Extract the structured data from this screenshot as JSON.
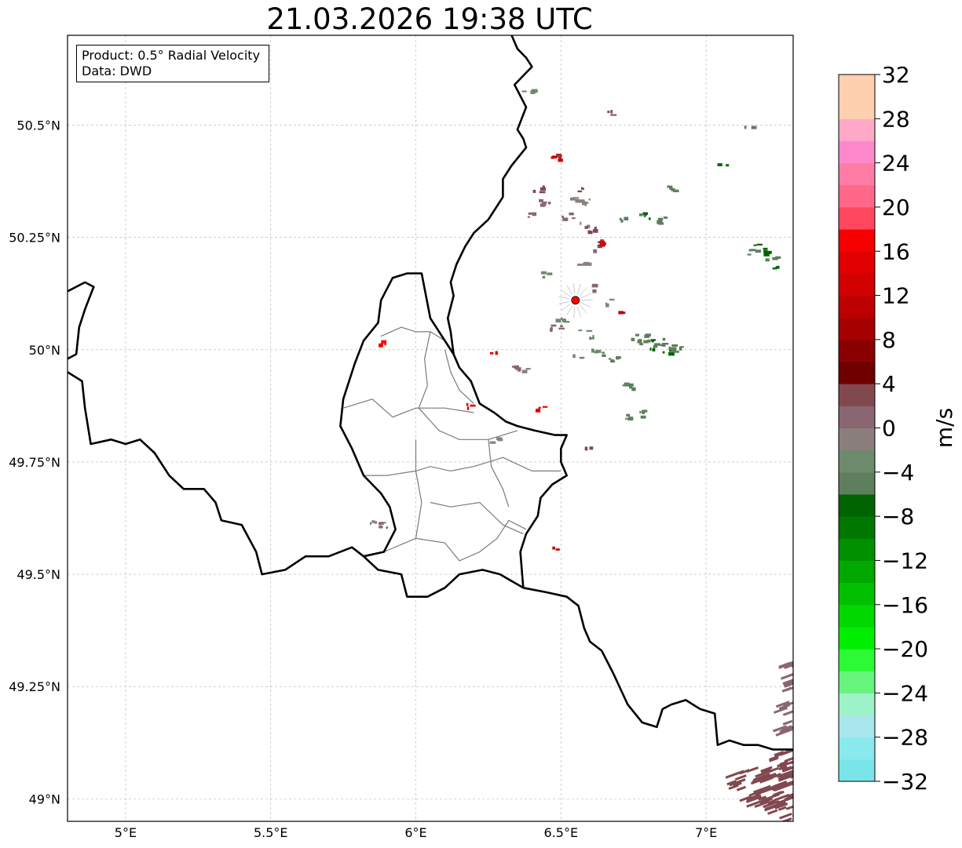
{
  "title": "21.03.2026 19:38 UTC",
  "info_box": {
    "product": "Product: 0.5° Radial Velocity",
    "data_source": "Data: DWD"
  },
  "map": {
    "extent": {
      "lon_min": 4.8,
      "lon_max": 7.3,
      "lat_min": 48.95,
      "lat_max": 50.7
    },
    "gridlines": true,
    "lon_ticks": [
      {
        "value": 5.0,
        "label": "5°E"
      },
      {
        "value": 5.5,
        "label": "5.5°E"
      },
      {
        "value": 6.0,
        "label": "6°E"
      },
      {
        "value": 6.5,
        "label": "6.5°E"
      },
      {
        "value": 7.0,
        "label": "7°E"
      }
    ],
    "lat_ticks": [
      {
        "value": 50.5,
        "label": "50.5°N"
      },
      {
        "value": 50.25,
        "label": "50.25°N"
      },
      {
        "value": 50.0,
        "label": "50°N"
      },
      {
        "value": 49.75,
        "label": "49.75°N"
      },
      {
        "value": 49.5,
        "label": "49.5°N"
      },
      {
        "value": 49.25,
        "label": "49.25°N"
      },
      {
        "value": 49.0,
        "label": "49°N"
      }
    ],
    "radar_site": {
      "lon": 6.55,
      "lat": 50.11,
      "color": "#ff0000"
    },
    "borders": {
      "belgium_germany": [
        [
          6.33,
          50.7
        ],
        [
          6.35,
          50.67
        ],
        [
          6.38,
          50.65
        ],
        [
          6.4,
          50.63
        ],
        [
          6.37,
          50.61
        ],
        [
          6.34,
          50.59
        ],
        [
          6.38,
          50.54
        ],
        [
          6.35,
          50.49
        ],
        [
          6.37,
          50.47
        ],
        [
          6.38,
          50.45
        ],
        [
          6.33,
          50.41
        ],
        [
          6.3,
          50.38
        ],
        [
          6.3,
          50.34
        ],
        [
          6.25,
          50.29
        ],
        [
          6.2,
          50.26
        ],
        [
          6.17,
          50.23
        ],
        [
          6.14,
          50.19
        ],
        [
          6.12,
          50.15
        ],
        [
          6.13,
          50.12
        ],
        [
          6.11,
          50.07
        ],
        [
          6.12,
          50.04
        ],
        [
          6.13,
          49.99
        ]
      ],
      "lux_germany": [
        [
          6.13,
          49.99
        ],
        [
          6.15,
          49.96
        ],
        [
          6.19,
          49.93
        ],
        [
          6.22,
          49.88
        ],
        [
          6.27,
          49.86
        ],
        [
          6.31,
          49.84
        ],
        [
          6.35,
          49.83
        ],
        [
          6.41,
          49.82
        ],
        [
          6.48,
          49.81
        ],
        [
          6.52,
          49.81
        ],
        [
          6.5,
          49.78
        ],
        [
          6.5,
          49.75
        ],
        [
          6.52,
          49.72
        ],
        [
          6.47,
          49.7
        ],
        [
          6.43,
          49.67
        ],
        [
          6.42,
          49.63
        ],
        [
          6.38,
          49.59
        ],
        [
          6.36,
          49.55
        ],
        [
          6.37,
          49.47
        ]
      ],
      "lux_belgium": [
        [
          6.13,
          49.99
        ],
        [
          6.05,
          50.07
        ],
        [
          6.02,
          50.17
        ],
        [
          5.97,
          50.17
        ],
        [
          5.92,
          50.16
        ],
        [
          5.88,
          50.11
        ],
        [
          5.87,
          50.06
        ],
        [
          5.82,
          50.02
        ],
        [
          5.79,
          49.97
        ],
        [
          5.75,
          49.89
        ],
        [
          5.74,
          49.83
        ],
        [
          5.78,
          49.78
        ],
        [
          5.82,
          49.72
        ],
        [
          5.88,
          49.68
        ],
        [
          5.91,
          49.65
        ],
        [
          5.93,
          49.6
        ],
        [
          5.89,
          49.55
        ],
        [
          5.82,
          49.54
        ]
      ],
      "france_lux": [
        [
          5.82,
          49.54
        ],
        [
          5.87,
          49.51
        ],
        [
          5.95,
          49.5
        ],
        [
          5.97,
          49.45
        ],
        [
          6.04,
          49.45
        ],
        [
          6.1,
          49.47
        ],
        [
          6.15,
          49.5
        ],
        [
          6.23,
          49.51
        ],
        [
          6.29,
          49.5
        ],
        [
          6.37,
          49.47
        ]
      ],
      "france_belgium": [
        [
          4.8,
          49.95
        ],
        [
          4.85,
          49.93
        ],
        [
          4.86,
          49.87
        ],
        [
          4.88,
          49.79
        ],
        [
          4.95,
          49.8
        ],
        [
          5.0,
          49.79
        ],
        [
          5.05,
          49.8
        ],
        [
          5.1,
          49.77
        ],
        [
          5.15,
          49.72
        ],
        [
          5.2,
          49.69
        ],
        [
          5.27,
          49.69
        ],
        [
          5.31,
          49.66
        ],
        [
          5.33,
          49.62
        ],
        [
          5.4,
          49.61
        ],
        [
          5.45,
          49.55
        ],
        [
          5.47,
          49.5
        ],
        [
          5.55,
          49.51
        ],
        [
          5.62,
          49.54
        ],
        [
          5.7,
          49.54
        ],
        [
          5.78,
          49.56
        ],
        [
          5.82,
          49.54
        ]
      ],
      "france_germany": [
        [
          6.37,
          49.47
        ],
        [
          6.45,
          49.46
        ],
        [
          6.52,
          49.45
        ],
        [
          6.56,
          49.43
        ],
        [
          6.58,
          49.38
        ],
        [
          6.6,
          49.35
        ],
        [
          6.64,
          49.33
        ],
        [
          6.68,
          49.28
        ],
        [
          6.73,
          49.21
        ],
        [
          6.78,
          49.17
        ],
        [
          6.83,
          49.16
        ],
        [
          6.85,
          49.2
        ],
        [
          6.88,
          49.21
        ],
        [
          6.93,
          49.22
        ],
        [
          6.98,
          49.2
        ],
        [
          7.03,
          49.19
        ],
        [
          7.04,
          49.12
        ],
        [
          7.08,
          49.13
        ],
        [
          7.13,
          49.12
        ],
        [
          7.18,
          49.12
        ],
        [
          7.23,
          49.11
        ],
        [
          7.3,
          49.11
        ]
      ],
      "belgium_nl": [
        [
          4.8,
          50.13
        ],
        [
          4.86,
          50.15
        ],
        [
          4.89,
          50.14
        ],
        [
          4.86,
          50.09
        ],
        [
          4.84,
          50.05
        ],
        [
          4.83,
          49.99
        ],
        [
          4.8,
          49.98
        ]
      ]
    },
    "cantons": [
      [
        [
          5.88,
          50.03
        ],
        [
          5.95,
          50.05
        ],
        [
          6.0,
          50.04
        ],
        [
          6.05,
          50.04
        ],
        [
          6.1,
          50.02
        ]
      ],
      [
        [
          6.05,
          50.04
        ],
        [
          6.03,
          49.98
        ],
        [
          6.04,
          49.92
        ],
        [
          6.01,
          49.87
        ]
      ],
      [
        [
          6.1,
          50.0
        ],
        [
          6.12,
          49.95
        ],
        [
          6.15,
          49.91
        ],
        [
          6.2,
          49.88
        ]
      ],
      [
        [
          5.75,
          49.87
        ],
        [
          5.85,
          49.89
        ],
        [
          5.92,
          49.85
        ],
        [
          6.0,
          49.87
        ],
        [
          6.1,
          49.87
        ],
        [
          6.2,
          49.86
        ]
      ],
      [
        [
          6.01,
          49.87
        ],
        [
          6.08,
          49.82
        ],
        [
          6.15,
          49.8
        ],
        [
          6.25,
          49.8
        ],
        [
          6.35,
          49.82
        ]
      ],
      [
        [
          5.82,
          49.72
        ],
        [
          5.9,
          49.72
        ],
        [
          6.0,
          49.73
        ],
        [
          6.05,
          49.74
        ],
        [
          6.12,
          49.73
        ],
        [
          6.2,
          49.74
        ],
        [
          6.3,
          49.76
        ],
        [
          6.4,
          49.73
        ],
        [
          6.5,
          49.73
        ]
      ],
      [
        [
          6.0,
          49.8
        ],
        [
          6.0,
          49.73
        ],
        [
          6.02,
          49.66
        ],
        [
          6.0,
          49.58
        ]
      ],
      [
        [
          6.05,
          49.66
        ],
        [
          6.12,
          49.65
        ],
        [
          6.22,
          49.66
        ],
        [
          6.3,
          49.61
        ],
        [
          6.37,
          49.59
        ]
      ],
      [
        [
          5.89,
          49.55
        ],
        [
          6.0,
          49.58
        ],
        [
          6.1,
          49.57
        ],
        [
          6.15,
          49.53
        ],
        [
          6.22,
          49.55
        ],
        [
          6.28,
          49.58
        ],
        [
          6.32,
          49.62
        ],
        [
          6.38,
          49.6
        ]
      ],
      [
        [
          6.25,
          49.8
        ],
        [
          6.26,
          49.74
        ],
        [
          6.3,
          49.69
        ],
        [
          6.32,
          49.65
        ]
      ]
    ],
    "echo_colors": [
      "#007800",
      "#009000",
      "#6e8a6e",
      "#8a7070",
      "#c80000",
      "#006400"
    ],
    "echoes": [
      {
        "lon": 6.79,
        "lat": 50.03,
        "v": -6
      },
      {
        "lon": 6.81,
        "lat": 50.02,
        "v": -7
      },
      {
        "lon": 6.83,
        "lat": 50.01,
        "v": -6
      },
      {
        "lon": 6.78,
        "lat": 50.02,
        "v": -5
      },
      {
        "lon": 6.86,
        "lat": 50.0,
        "v": -7
      },
      {
        "lon": 6.9,
        "lat": 50.01,
        "v": -6
      },
      {
        "lon": 6.88,
        "lat": 50.0,
        "v": -5
      },
      {
        "lon": 6.85,
        "lat": 50.02,
        "v": -6
      },
      {
        "lon": 6.82,
        "lat": 50.0,
        "v": -7
      },
      {
        "lon": 6.76,
        "lat": 50.03,
        "v": -6
      },
      {
        "lon": 7.18,
        "lat": 50.23,
        "v": -7
      },
      {
        "lon": 7.2,
        "lat": 50.22,
        "v": -7
      },
      {
        "lon": 7.22,
        "lat": 50.21,
        "v": -6
      },
      {
        "lon": 7.23,
        "lat": 50.19,
        "v": -7
      },
      {
        "lon": 7.16,
        "lat": 50.22,
        "v": -6
      },
      {
        "lon": 6.77,
        "lat": 50.3,
        "v": -6
      },
      {
        "lon": 6.8,
        "lat": 50.3,
        "v": -7
      },
      {
        "lon": 6.84,
        "lat": 50.29,
        "v": -6
      },
      {
        "lon": 7.05,
        "lat": 50.41,
        "v": -7
      },
      {
        "lon": 7.14,
        "lat": 50.5,
        "v": -6
      },
      {
        "lon": 6.87,
        "lat": 50.36,
        "v": -6
      },
      {
        "lon": 6.78,
        "lat": 49.86,
        "v": -6
      },
      {
        "lon": 6.74,
        "lat": 49.85,
        "v": -5
      },
      {
        "lon": 6.73,
        "lat": 49.92,
        "v": -6
      },
      {
        "lon": 6.65,
        "lat": 49.99,
        "v": -5
      },
      {
        "lon": 6.62,
        "lat": 50.0,
        "v": -4
      },
      {
        "lon": 6.68,
        "lat": 49.98,
        "v": -6
      },
      {
        "lon": 6.6,
        "lat": 50.03,
        "v": -5
      },
      {
        "lon": 6.63,
        "lat": 50.24,
        "v": 2
      },
      {
        "lon": 6.61,
        "lat": 50.22,
        "v": 0
      },
      {
        "lon": 6.58,
        "lat": 50.28,
        "v": -2
      },
      {
        "lon": 6.59,
        "lat": 50.33,
        "v": -1
      },
      {
        "lon": 6.6,
        "lat": 50.27,
        "v": 3
      },
      {
        "lon": 6.64,
        "lat": 50.24,
        "v": 14
      },
      {
        "lon": 6.48,
        "lat": 50.43,
        "v": 12
      },
      {
        "lon": 6.5,
        "lat": 50.43,
        "v": 2
      },
      {
        "lon": 6.4,
        "lat": 50.3,
        "v": 1
      },
      {
        "lon": 6.44,
        "lat": 50.33,
        "v": 0
      },
      {
        "lon": 6.42,
        "lat": 50.36,
        "v": 3
      },
      {
        "lon": 6.38,
        "lat": 49.96,
        "v": -2
      },
      {
        "lon": 6.35,
        "lat": 49.96,
        "v": 1
      },
      {
        "lon": 6.27,
        "lat": 49.99,
        "v": 14
      },
      {
        "lon": 6.19,
        "lat": 49.88,
        "v": 14
      },
      {
        "lon": 5.88,
        "lat": 50.02,
        "v": 16
      },
      {
        "lon": 6.42,
        "lat": 49.87,
        "v": 14
      },
      {
        "lon": 6.27,
        "lat": 49.8,
        "v": -2
      },
      {
        "lon": 5.86,
        "lat": 49.62,
        "v": -2
      },
      {
        "lon": 5.88,
        "lat": 49.61,
        "v": 1
      },
      {
        "lon": 6.48,
        "lat": 49.56,
        "v": 10
      },
      {
        "lon": 6.6,
        "lat": 49.78,
        "v": 2
      },
      {
        "lon": 6.38,
        "lat": 50.58,
        "v": -3
      },
      {
        "lon": 6.67,
        "lat": 50.53,
        "v": 2
      },
      {
        "lon": 6.7,
        "lat": 50.29,
        "v": -5
      },
      {
        "lon": 6.52,
        "lat": 50.3,
        "v": 1
      },
      {
        "lon": 6.56,
        "lat": 50.36,
        "v": 2
      },
      {
        "lon": 6.55,
        "lat": 50.34,
        "v": -1
      },
      {
        "lon": 6.57,
        "lat": 50.04,
        "v": -3
      },
      {
        "lon": 6.6,
        "lat": 50.14,
        "v": 1
      },
      {
        "lon": 6.65,
        "lat": 50.11,
        "v": -2
      },
      {
        "lon": 6.71,
        "lat": 50.09,
        "v": 10
      },
      {
        "lon": 6.5,
        "lat": 50.07,
        "v": -3
      },
      {
        "lon": 6.48,
        "lat": 50.05,
        "v": 0
      },
      {
        "lon": 6.55,
        "lat": 49.99,
        "v": -4
      },
      {
        "lon": 6.57,
        "lat": 50.19,
        "v": -2
      },
      {
        "lon": 6.45,
        "lat": 50.17,
        "v": -3
      }
    ],
    "clutter_patches": [
      {
        "lon": 7.22,
        "lat": 49.05,
        "v": 2
      },
      {
        "lon": 7.2,
        "lat": 49.03,
        "v": 3
      },
      {
        "lon": 7.25,
        "lat": 49.06,
        "v": 2
      },
      {
        "lon": 7.15,
        "lat": 49.02,
        "v": 3
      },
      {
        "lon": 7.18,
        "lat": 49.0,
        "v": 2
      },
      {
        "lon": 7.22,
        "lat": 48.99,
        "v": 3
      },
      {
        "lon": 7.27,
        "lat": 49.02,
        "v": 2
      },
      {
        "lon": 7.12,
        "lat": 49.05,
        "v": 3
      },
      {
        "lon": 7.26,
        "lat": 48.97,
        "v": 2
      },
      {
        "lon": 7.28,
        "lat": 49.2,
        "v": 1
      },
      {
        "lon": 7.28,
        "lat": 49.26,
        "v": 1
      },
      {
        "lon": 7.29,
        "lat": 49.3,
        "v": 1
      },
      {
        "lon": 7.27,
        "lat": 49.16,
        "v": 1
      },
      {
        "lon": 7.24,
        "lat": 49.08,
        "v": 2
      }
    ]
  },
  "colorbar": {
    "unit": "m/s",
    "min": -32,
    "max": 32,
    "ticks": [
      "−32",
      "−28",
      "−24",
      "−20",
      "−16",
      "−12",
      "−8",
      "−4",
      "0",
      "4",
      "8",
      "12",
      "16",
      "20",
      "24",
      "28",
      "32"
    ],
    "tick_values": [
      -32,
      -28,
      -24,
      -20,
      -16,
      -12,
      -8,
      -4,
      0,
      4,
      8,
      12,
      16,
      20,
      24,
      28,
      32
    ],
    "colors": [
      "#7ae5e8",
      "#8ae9ec",
      "#a8e8ec",
      "#9ef2c8",
      "#66f47c",
      "#2dfa36",
      "#00ee00",
      "#00d800",
      "#00c000",
      "#00a800",
      "#009000",
      "#007800",
      "#006400",
      "#5e7e5e",
      "#6d8a6d",
      "#8a7f7c",
      "#896672",
      "#824850",
      "#6e0000",
      "#8a0000",
      "#a40000",
      "#bc0000",
      "#d20000",
      "#e00000",
      "#f60000",
      "#ff4860",
      "#ff6888",
      "#ff7ca4",
      "#ff88cc",
      "#ffa8c8",
      "#ffd0b0",
      "#ffd0b0"
    ]
  }
}
